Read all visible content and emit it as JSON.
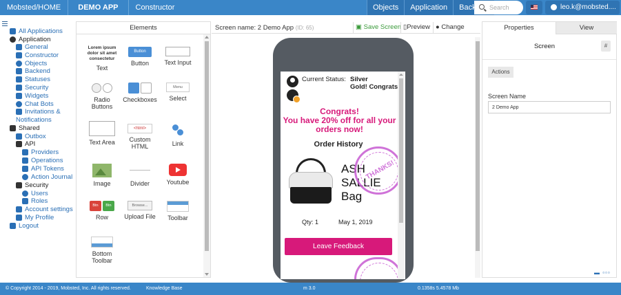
{
  "topbar": {
    "brand": "Mobsted/HOME",
    "app": "DEMO APP",
    "section": "Constructor",
    "nav": [
      "Objects",
      "Application",
      "Backend"
    ],
    "search_placeholder": "Search",
    "user": "leo.k@mobsted...."
  },
  "sidebar": {
    "items": [
      {
        "label": "All Applications",
        "kind": "link"
      },
      {
        "label": "Application",
        "kind": "dark"
      },
      {
        "label": "General",
        "kind": "link"
      },
      {
        "label": "Constructor",
        "kind": "link"
      },
      {
        "label": "Objects",
        "kind": "link"
      },
      {
        "label": "Backend",
        "kind": "link"
      },
      {
        "label": "Statuses",
        "kind": "link"
      },
      {
        "label": "Security",
        "kind": "link"
      },
      {
        "label": "Widgets",
        "kind": "link"
      },
      {
        "label": "Chat Bots",
        "kind": "link"
      },
      {
        "label": "Invitations &",
        "kind": "link"
      },
      {
        "label": "Notifications",
        "kind": "link"
      },
      {
        "label": "Shared",
        "kind": "dark"
      },
      {
        "label": "Outbox",
        "kind": "link"
      },
      {
        "label": "API",
        "kind": "dark"
      },
      {
        "label": "Providers",
        "kind": "link"
      },
      {
        "label": "Operations",
        "kind": "link"
      },
      {
        "label": "API Tokens",
        "kind": "link"
      },
      {
        "label": "Action Journal",
        "kind": "link"
      },
      {
        "label": "Security",
        "kind": "dark"
      },
      {
        "label": "Users",
        "kind": "link"
      },
      {
        "label": "Roles",
        "kind": "link"
      },
      {
        "label": "Account settings",
        "kind": "link"
      },
      {
        "label": "My Profile",
        "kind": "link"
      },
      {
        "label": "Logout",
        "kind": "link"
      }
    ]
  },
  "elements": {
    "title": "Elements",
    "lorem": "Lorem ipsum dolor sit amet consectetur",
    "button_preview": "Button",
    "select_preview": "Menu",
    "html_preview": "<html>",
    "row_btn": "Btn",
    "browse_preview": "Browse...",
    "items": [
      {
        "label": "Text"
      },
      {
        "label": "Button"
      },
      {
        "label": "Text Input"
      },
      {
        "label": "Radio Buttons"
      },
      {
        "label": "Checkboxes"
      },
      {
        "label": "Select"
      },
      {
        "label": "Text Area"
      },
      {
        "label": "Custom HTML"
      },
      {
        "label": "Link"
      },
      {
        "label": "Image"
      },
      {
        "label": "Divider"
      },
      {
        "label": "Youtube"
      },
      {
        "label": "Row"
      },
      {
        "label": "Upload File"
      },
      {
        "label": "Toolbar"
      },
      {
        "label": "Bottom Toolbar"
      }
    ]
  },
  "screen": {
    "name_label": "Screen name: 2 Demo App",
    "id_label": "(ID: 65)",
    "save": "Save Screen",
    "preview": "Preview",
    "change_view": "Change View"
  },
  "phone": {
    "status_label": "Current Status:",
    "status_value_1": "Silver",
    "status_value_2": "Gold! Congrats!",
    "congrats_1": "Congrats!",
    "congrats_2": "You have 20% off for all your orders now!",
    "order_title": "Order History",
    "product": [
      "ASH",
      "SALLIE",
      "Bag"
    ],
    "qty": "Qty: 1",
    "date": "May 1, 2019",
    "feedback": "Leave Feedback",
    "stamp_text": "THANKS!"
  },
  "properties": {
    "tab_properties": "Properties",
    "tab_view": "View",
    "title": "Screen",
    "hash": "#",
    "actions": "Actions",
    "field_label": "Screen Name",
    "field_value": "2 Demo App"
  },
  "footer": {
    "copyright": "© Copyright 2014 - 2019, Mobsted, Inc. All rights reserved.",
    "kb": "Knowledge Base",
    "version": "m 3.0",
    "perf": "0.1358s 5.4578 Mb"
  },
  "colors": {
    "topbar": "#3a86c8",
    "accent_pink": "#d7197a",
    "link": "#2a6fb5",
    "save_green": "#3a9a3a"
  }
}
